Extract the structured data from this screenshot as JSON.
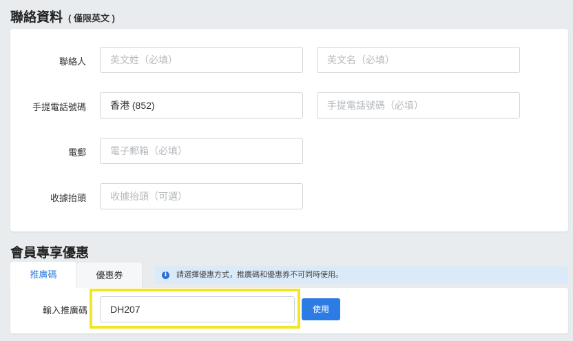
{
  "contact": {
    "title": "聯絡資料",
    "subtitle": "( 僅限英文 )",
    "rows": [
      {
        "label": "聯絡人"
      },
      {
        "label": "手提電話號碼"
      },
      {
        "label": "電郵"
      },
      {
        "label": "收據抬頭"
      }
    ],
    "fields": {
      "last_name_placeholder": "英文姓（必填）",
      "first_name_placeholder": "英文名（必填）",
      "country_code_value": "香港 (852)",
      "phone_placeholder": "手提電話號碼（必填）",
      "email_placeholder": "電子郵箱（必填）",
      "receipt_placeholder": "收據抬頭（可選）"
    }
  },
  "member": {
    "title": "會員專享優惠",
    "tabs": [
      {
        "label": "推廣碼",
        "active": true
      },
      {
        "label": "優惠券",
        "active": false
      }
    ],
    "notice": "請選擇優惠方式，推廣碼和優惠券不可同時使用。",
    "promo_label": "輸入推廣碼",
    "promo_value": "DH207",
    "use_button": "使用"
  },
  "colors": {
    "accent": "#2d7be5",
    "highlight": "#f2e622",
    "notice_bg": "#dbeaf9"
  }
}
